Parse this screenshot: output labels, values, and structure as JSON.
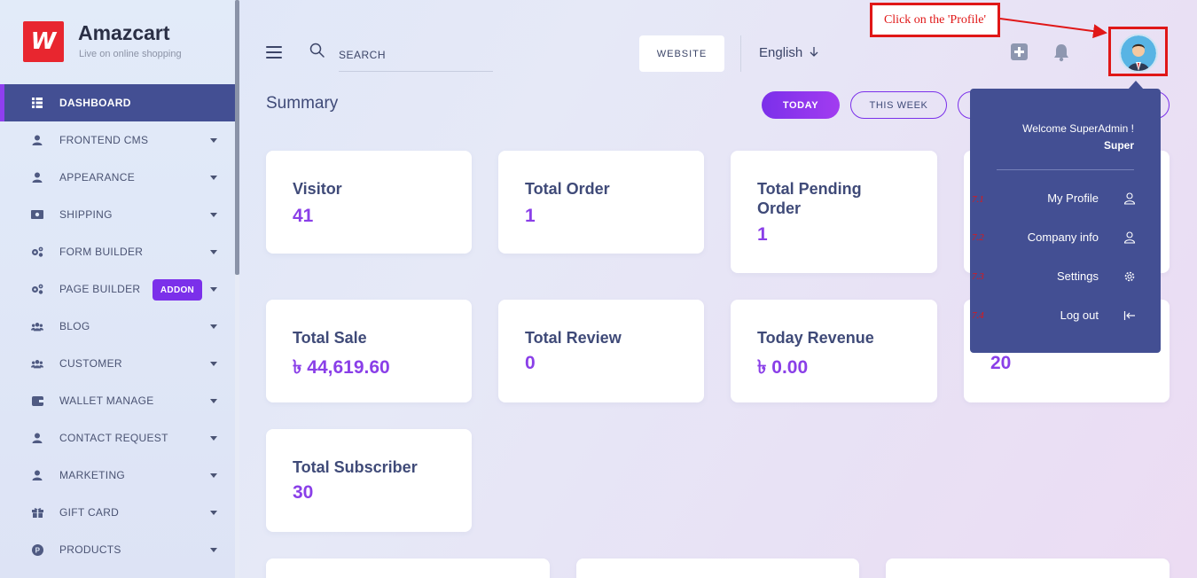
{
  "brand": {
    "name": "Amazcart",
    "tagline": "Live on online shopping",
    "logo_glyph": "W"
  },
  "sidebar": {
    "items": [
      {
        "label": "DASHBOARD",
        "icon": "grid-icon",
        "active": true
      },
      {
        "label": "FRONTEND CMS",
        "icon": "user-icon"
      },
      {
        "label": "APPEARANCE",
        "icon": "user-icon"
      },
      {
        "label": "SHIPPING",
        "icon": "money-icon"
      },
      {
        "label": "FORM BUILDER",
        "icon": "gears-icon"
      },
      {
        "label": "PAGE BUILDER",
        "icon": "gears-icon",
        "badge": "ADDON"
      },
      {
        "label": "BLOG",
        "icon": "users-icon"
      },
      {
        "label": "CUSTOMER",
        "icon": "users-icon"
      },
      {
        "label": "WALLET MANAGE",
        "icon": "wallet-icon"
      },
      {
        "label": "CONTACT REQUEST",
        "icon": "user-icon"
      },
      {
        "label": "MARKETING",
        "icon": "user-icon"
      },
      {
        "label": "GIFT CARD",
        "icon": "gift-icon"
      },
      {
        "label": "PRODUCTS",
        "icon": "product-icon"
      }
    ]
  },
  "topbar": {
    "search_placeholder": "SEARCH",
    "website_label": "WEBSITE",
    "language": "English"
  },
  "annotation": {
    "callout": "Click on the 'Profile'",
    "steps": [
      "7.1",
      "7.2",
      "7.3",
      "7.4"
    ],
    "color": "#e01717"
  },
  "summary": {
    "title": "Summary",
    "filters": [
      "TODAY",
      "THIS WEEK"
    ],
    "cards": [
      {
        "title": "Visitor",
        "value": "41"
      },
      {
        "title": "Total Order",
        "value": "1"
      },
      {
        "title": "Total Pending Order",
        "value": "1"
      },
      {
        "title": "Total Sale",
        "value": "৳ 44,619.60"
      },
      {
        "title": "Total Review",
        "value": "0"
      },
      {
        "title": "Today Revenue",
        "value": "৳ 0.00"
      },
      {
        "title": "",
        "value": "20"
      },
      {
        "title": "Total Subscriber",
        "value": "30"
      }
    ]
  },
  "profile_menu": {
    "welcome": "Welcome SuperAdmin !",
    "name": "Super",
    "items": [
      {
        "label": "My Profile",
        "icon": "user-outline-icon"
      },
      {
        "label": "Company info",
        "icon": "user-outline-icon"
      },
      {
        "label": "Settings",
        "icon": "gear-icon"
      },
      {
        "label": "Log out",
        "icon": "logout-icon"
      }
    ]
  },
  "colors": {
    "accent": "#7b30ea",
    "sidebar_active": "#434f93",
    "value": "#8a3fe8",
    "heading": "#3f4a78"
  }
}
